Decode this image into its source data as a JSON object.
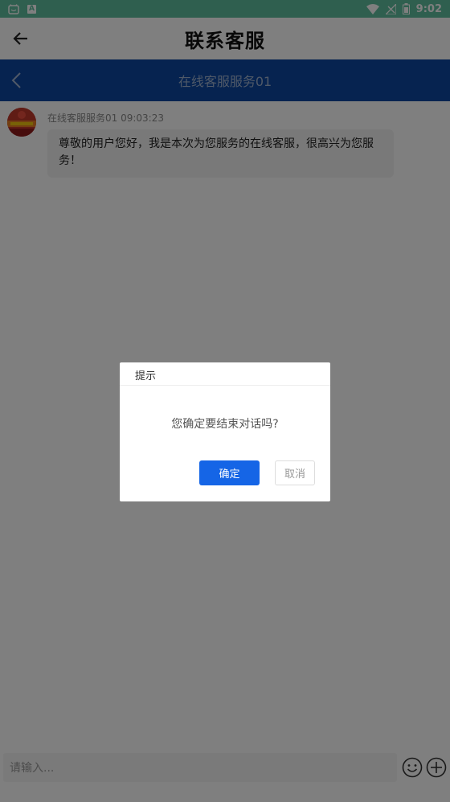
{
  "status_bar": {
    "time": "9:02",
    "notif_a": "A"
  },
  "app_bar": {
    "title": "联系客服"
  },
  "chat_header": {
    "title": "在线客服服务01"
  },
  "messages": [
    {
      "sender": "在线客服服务01",
      "time": "09:03:23",
      "meta": "在线客服服务01 09:03:23",
      "text": "尊敬的用户您好，我是本次为您服务的在线客服，很高兴为您服务！"
    }
  ],
  "input": {
    "placeholder": "请输入..."
  },
  "dialog": {
    "title": "提示",
    "message": "您确定要结束对话吗?",
    "confirm_label": "确定",
    "cancel_label": "取消"
  },
  "colors": {
    "status_bar": "#5fbf9f",
    "chat_header": "#0d47a1",
    "confirm_button": "#1565e6"
  }
}
